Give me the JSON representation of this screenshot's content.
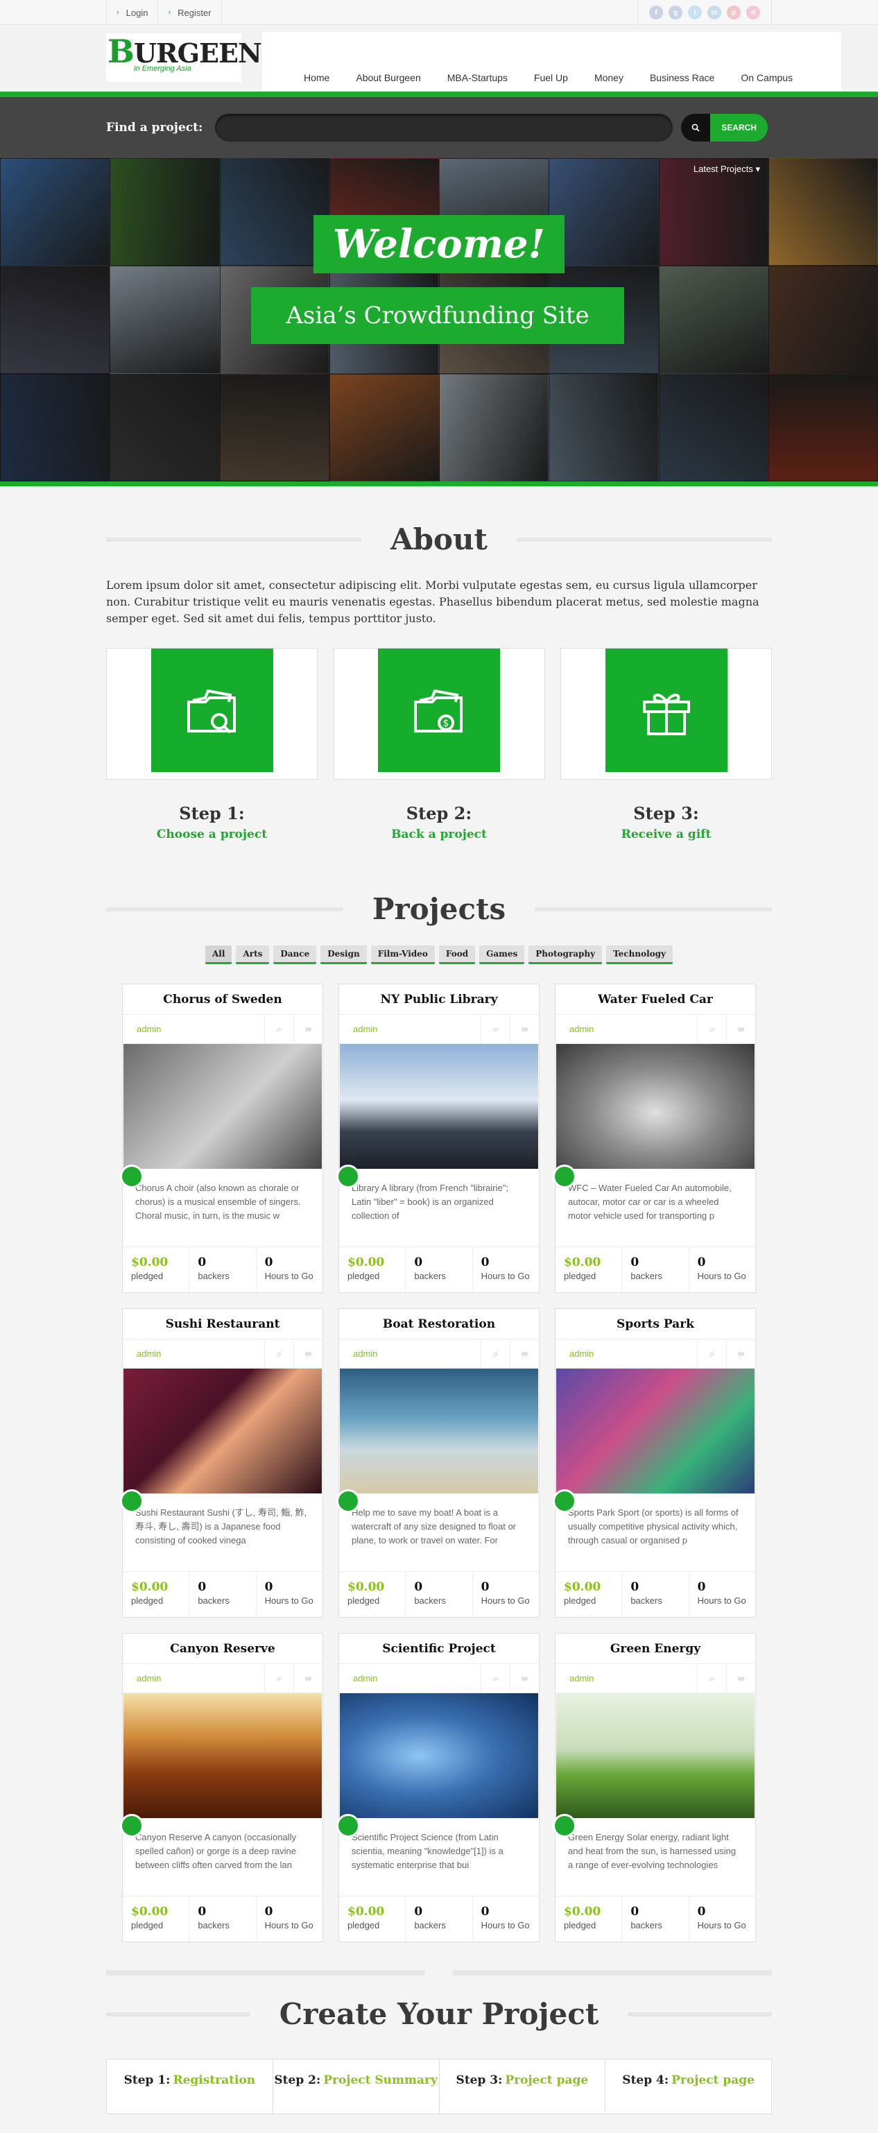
{
  "topbar": {
    "login": "Login",
    "register": "Register",
    "social": [
      {
        "icon": "facebook-icon",
        "glyph": "f",
        "color": "#c8d3e6"
      },
      {
        "icon": "googleplus-icon",
        "glyph": "g",
        "color": "#c8d3e6"
      },
      {
        "icon": "twitter-icon",
        "glyph": "t",
        "color": "#c8e2f2"
      },
      {
        "icon": "linkedin-icon",
        "glyph": "in",
        "color": "#c8dbec"
      },
      {
        "icon": "pinterest-icon",
        "glyph": "p",
        "color": "#f0c4c8"
      },
      {
        "icon": "dribbble-icon",
        "glyph": "d",
        "color": "#f2c8d8"
      }
    ]
  },
  "header": {
    "logo_text": "URGEEN",
    "logo_initial": "B",
    "logo_tagline": "in Emerging Asia",
    "nav": [
      "Home",
      "About Burgeen",
      "MBA-Startups",
      "Fuel Up",
      "Money",
      "Business Race",
      "On Campus"
    ]
  },
  "search": {
    "label": "Find a project:",
    "placeholder": "",
    "button": "SEARCH"
  },
  "hero": {
    "latest": "Latest Projects ▾",
    "welcome": "Welcome!",
    "tagline": "Asia’s Crowdfunding Site"
  },
  "about": {
    "title": "About",
    "text": "Lorem ipsum dolor sit amet, consectetur adipiscing elit. Morbi vulputate egestas sem, eu cursus ligula ullamcorper non. Curabitur tristique velit eu mauris venenatis egestas. Phasellus bibendum placerat metus, sed molestie magna semper eget. Sed sit amet dui felis, tempus porttitor justo.",
    "steps": [
      {
        "num": "Step 1:",
        "label": "Choose a project",
        "icon": "folder-search-icon"
      },
      {
        "num": "Step 2:",
        "label": "Back a project",
        "icon": "folder-money-icon"
      },
      {
        "num": "Step 3:",
        "label": "Receive a gift",
        "icon": "gift-icon"
      }
    ]
  },
  "projects": {
    "title": "Projects",
    "filters": [
      "All",
      "Arts",
      "Dance",
      "Design",
      "Film-Video",
      "Food",
      "Games",
      "Photography",
      "Technology"
    ],
    "labels": {
      "pledged": "pledged",
      "backers": "backers",
      "hours": "Hours to Go",
      "author": "admin"
    },
    "items": [
      {
        "title": "Chorus of Sweden",
        "desc": "Chorus A choir (also known as chorale or chorus) is a musical ensemble of singers. Choral music, in turn, is the music w",
        "pledged": "$0.00",
        "backers": "0",
        "hours": "0",
        "img": "linear-gradient(135deg,#6b6b6b,#cfcfcf 55%,#444)"
      },
      {
        "title": "NY Public Library",
        "desc": "Library A library (from French \"librairie\"; Latin \"liber\" = book) is an organized collection of",
        "pledged": "$0.00",
        "backers": "0",
        "hours": "0",
        "img": "linear-gradient(180deg,#8fb2d6,#dfe8f2 45%,#3a4250 70%,#1d2127)"
      },
      {
        "title": "Water Fueled Car",
        "desc": "WFC – Water Fueled Car An automobile, autocar, motor car or car is a wheeled motor vehicle used for transporting p",
        "pledged": "$0.00",
        "backers": "0",
        "hours": "0",
        "img": "radial-gradient(ellipse at 50% 55%,#e0e0e0,#8a8a8a 45%,#3a3a3a)"
      },
      {
        "title": "Sushi Restaurant",
        "desc": "Sushi Restaurant Sushi (すし, 寿司, 鮨, 鮓, 寿斗, 寿し, 壽司) is a Japanese food consisting of cooked vinega",
        "pledged": "$0.00",
        "backers": "0",
        "hours": "0",
        "img": "linear-gradient(135deg,#7a1c3a,#4a1226 40%,#e8a27a 55%,#2a0f18)"
      },
      {
        "title": "Boat Restoration",
        "desc": "Help me to save my boat! A boat is a watercraft of any size designed to float or plane, to work or travel on water. For",
        "pledged": "$0.00",
        "backers": "0",
        "hours": "0",
        "img": "linear-gradient(180deg,#2e5f82,#6aa2c4 40%,#c9d8df 65%,#d8c9a8)"
      },
      {
        "title": "Sports Park",
        "desc": "Sports Park Sport (or sports) is all forms of usually competitive physical activity which, through casual or organised p",
        "pledged": "$0.00",
        "backers": "0",
        "hours": "0",
        "img": "linear-gradient(135deg,#5a4aa8,#c94f8a 40%,#38b27a 70%,#2c3c7a)"
      },
      {
        "title": "Canyon Reserve",
        "desc": "Canyon Reserve A canyon (occasionally spelled cañon) or gorge is a deep ravine between cliffs often carved from the lan",
        "pledged": "$0.00",
        "backers": "0",
        "hours": "0",
        "img": "linear-gradient(180deg,#f4e1a8,#d08a3a 35%,#8a3a12 65%,#4a1c08)"
      },
      {
        "title": "Scientific Project",
        "desc": "Scientific Project Science (from Latin scientia, meaning \"knowledge\"[1]) is a systematic enterprise that bui",
        "pledged": "$0.00",
        "backers": "0",
        "hours": "0",
        "img": "radial-gradient(ellipse at 40% 50%,#8fc6f2,#3a6fb2 45%,#12325e)"
      },
      {
        "title": "Green Energy",
        "desc": "Green Energy Solar energy, radiant light and heat from the sun, is harnessed using a range of ever-evolving technologies",
        "pledged": "$0.00",
        "backers": "0",
        "hours": "0",
        "img": "linear-gradient(180deg,#e8f2e0,#c8dcb8 45%,#6aa83a 65%,#2f5a1a)"
      }
    ]
  },
  "create": {
    "title": "Create Your Project",
    "steps": [
      {
        "num": "Step 1:",
        "label": "Registration"
      },
      {
        "num": "Step 2:",
        "label": "Project Summary"
      },
      {
        "num": "Step 3:",
        "label": "Project page"
      },
      {
        "num": "Step 4:",
        "label": "Project page"
      }
    ]
  },
  "colors": {
    "accent": "#1cab2f",
    "lime": "#8ac11d"
  }
}
